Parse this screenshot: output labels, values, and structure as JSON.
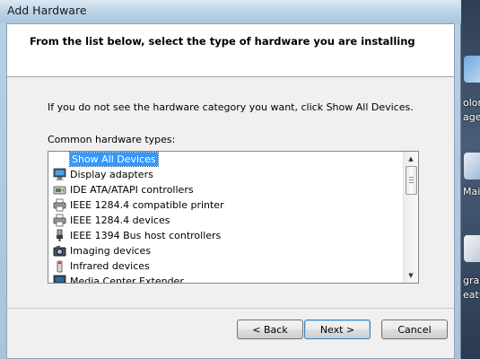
{
  "window": {
    "title": "Add Hardware",
    "header": "From the list below, select the type of hardware you are installing"
  },
  "content": {
    "hint": "If you do not see the hardware category you want, click Show All Devices.",
    "list_label": "Common hardware types:",
    "items": [
      {
        "label": "Show All Devices",
        "icon": "none",
        "selected": true
      },
      {
        "label": "Display adapters",
        "icon": "monitor-icon"
      },
      {
        "label": "IDE ATA/ATAPI controllers",
        "icon": "drive-controller-icon"
      },
      {
        "label": "IEEE 1284.4 compatible printer",
        "icon": "printer-icon"
      },
      {
        "label": "IEEE 1284.4 devices",
        "icon": "printer-icon"
      },
      {
        "label": "IEEE 1394 Bus host controllers",
        "icon": "usb-plug-icon"
      },
      {
        "label": "Imaging devices",
        "icon": "camera-icon"
      },
      {
        "label": "Infrared devices",
        "icon": "infrared-icon"
      },
      {
        "label": "Media Center Extender",
        "icon": "monitor-icon"
      }
    ]
  },
  "buttons": {
    "back": "< Back",
    "next": "Next >",
    "cancel": "Cancel"
  },
  "desktop": {
    "labels": [
      "olor",
      "ager",
      "Mail",
      "gran",
      "eatu"
    ]
  },
  "colors": {
    "selection": "#3399ff",
    "window_frame": "#b7cfe2",
    "dialog_bg": "#f0f0f0"
  }
}
